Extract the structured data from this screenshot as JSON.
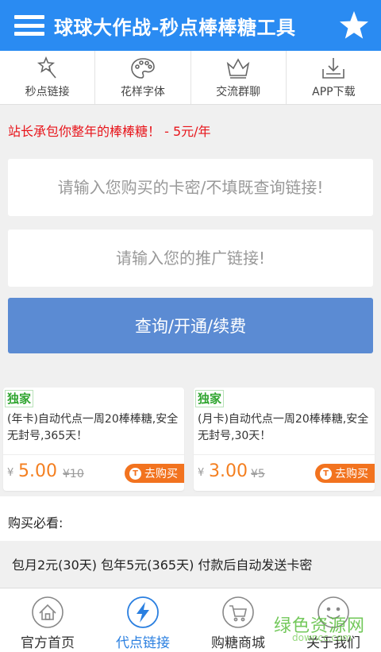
{
  "header": {
    "title": "球球大作战-秒点棒棒糖工具"
  },
  "topnav": [
    {
      "label": "秒点链接",
      "icon": "magic-wand-icon"
    },
    {
      "label": "花样字体",
      "icon": "palette-icon"
    },
    {
      "label": "交流群聊",
      "icon": "crown-icon"
    },
    {
      "label": "APP下载",
      "icon": "download-icon"
    }
  ],
  "notice": "站长承包你整年的棒棒糖！ - 5元/年",
  "form": {
    "card_placeholder": "请输入您购买的卡密/不填既查询链接!",
    "promo_placeholder": "请输入您的推广链接!",
    "submit_label": "查询/开通/续费"
  },
  "products": [
    {
      "badge": "独家",
      "desc": "(年卡)自动代点一周20棒棒糖,安全无封号,365天！",
      "currency": "¥",
      "price": "5.00",
      "original": "¥10",
      "buy_label": "去购买",
      "buy_icon_text": "T"
    },
    {
      "badge": "独家",
      "desc": "(月卡)自动代点一周20棒棒糖,安全无封号,30天！",
      "currency": "¥",
      "price": "3.00",
      "original": "¥5",
      "buy_label": "去购买",
      "buy_icon_text": "T"
    }
  ],
  "must_read": "购买必看:",
  "info": "包月2元(30天) 包年5元(365天) 付款后自动发送卡密",
  "bottomnav": [
    {
      "label": "官方首页",
      "icon": "home-icon",
      "active": false
    },
    {
      "label": "代点链接",
      "icon": "lightning-icon",
      "active": true
    },
    {
      "label": "购糖商城",
      "icon": "cart-icon",
      "active": false
    },
    {
      "label": "关于我们",
      "icon": "smiley-icon",
      "active": false
    }
  ],
  "watermark": {
    "text": "绿色资源网",
    "sub": "downcc.com"
  },
  "colors": {
    "primary": "#2a8bf2",
    "button": "#5b8bd3",
    "price": "#f47f20",
    "notice": "#e8151b",
    "badge": "#2fa52f"
  }
}
